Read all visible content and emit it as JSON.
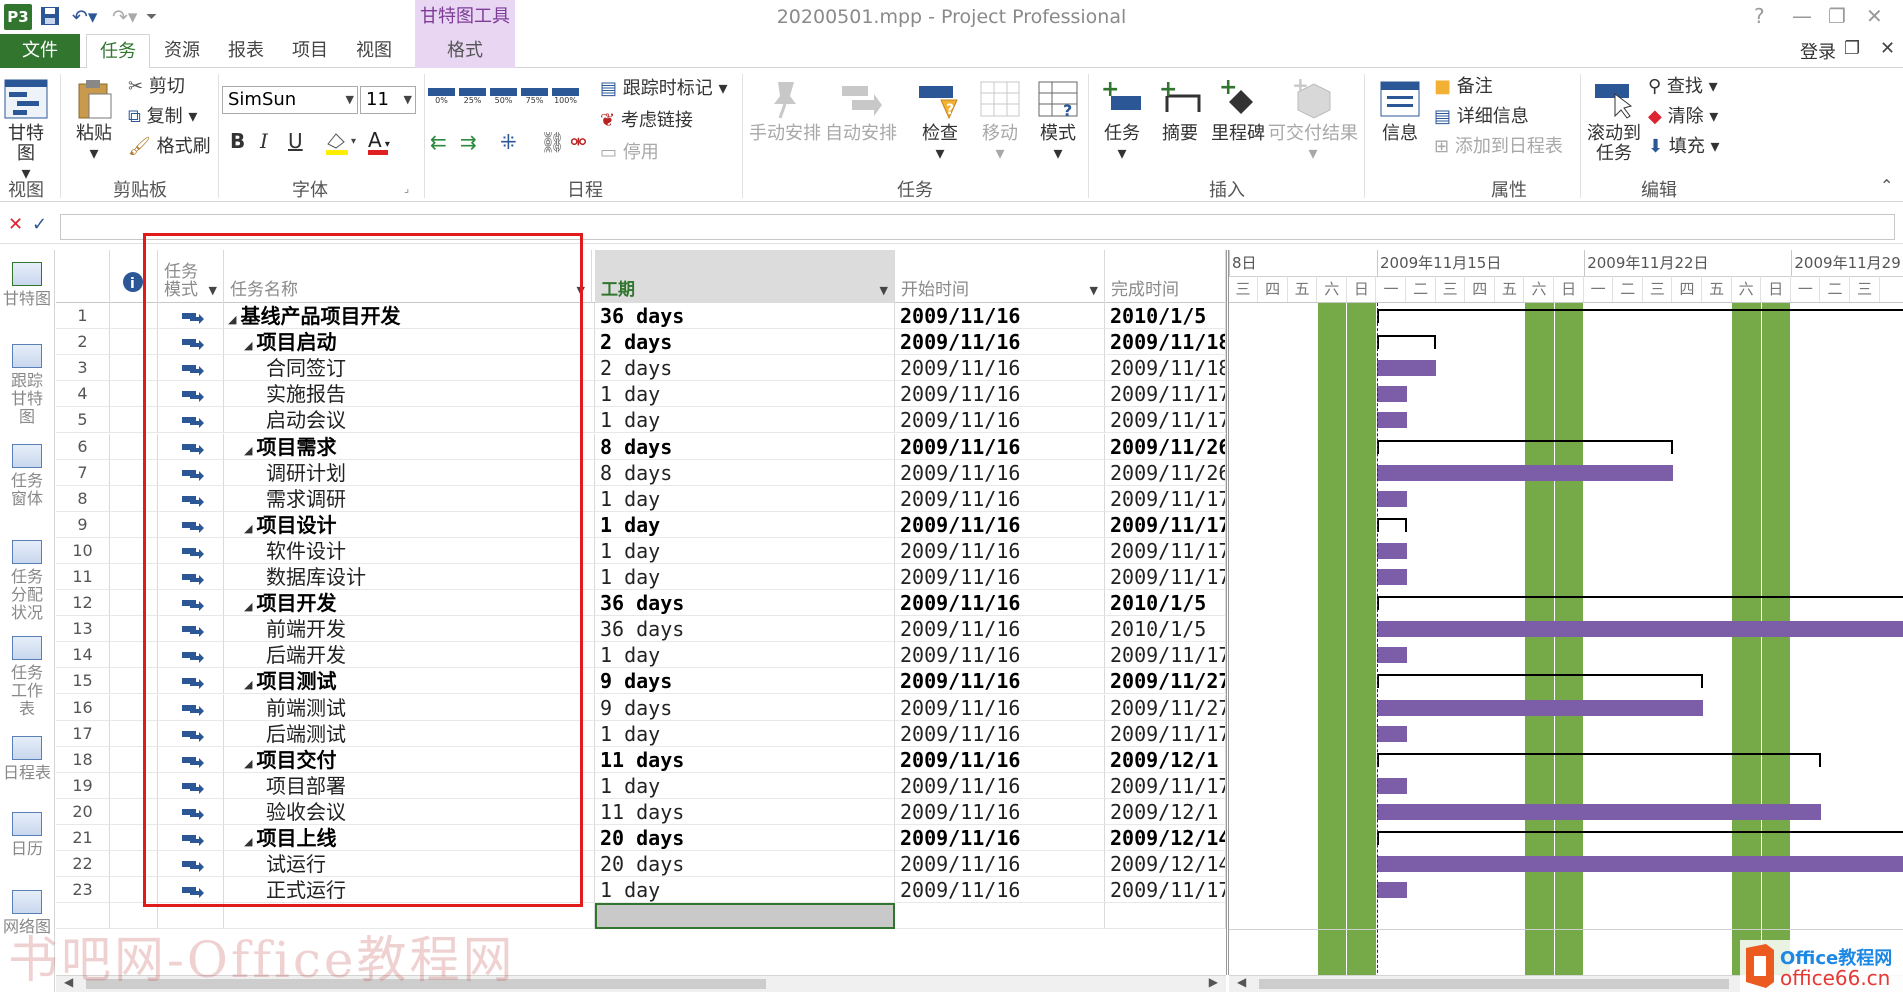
{
  "title_bar": {
    "app_icon": "P3",
    "window_title": "20200501.mpp - Project Professional",
    "context_tab_group": "甘特图工具",
    "help": "?",
    "signin": "登录"
  },
  "tabs": [
    "文件",
    "任务",
    "资源",
    "报表",
    "项目",
    "视图",
    "格式"
  ],
  "ribbon": {
    "view": {
      "gantt_chart": "甘特图",
      "group": "视图"
    },
    "clipboard": {
      "paste": "粘贴",
      "cut": "剪切",
      "copy": "复制",
      "format_painter": "格式刷",
      "group": "剪贴板"
    },
    "font": {
      "name": "SimSun",
      "size": "11",
      "bold": "B",
      "italic": "I",
      "underline": "U",
      "font_color": "A",
      "group": "字体"
    },
    "schedule": {
      "percent_buttons": [
        "0%",
        "25%",
        "50%",
        "75%",
        "100%"
      ],
      "track": "跟踪时标记",
      "respect_links": "考虑链接",
      "inactivate": "停用",
      "group": "日程"
    },
    "tasks": {
      "manual": "手动安排",
      "auto": "自动安排",
      "inspect": "检查",
      "move": "移动",
      "mode": "模式",
      "group": "任务"
    },
    "insert": {
      "task": "任务",
      "summary": "摘要",
      "milestone": "里程碑",
      "deliverable": "可交付结果",
      "group": "插入"
    },
    "properties": {
      "info": "信息",
      "notes": "备注",
      "details": "详细信息",
      "add_timeline": "添加到日程表",
      "group": "属性"
    },
    "editing": {
      "scroll_to_task": "滚动到任务",
      "find": "查找",
      "clear": "清除",
      "fill": "填充",
      "group": "编辑"
    }
  },
  "viewbar": [
    "甘特图",
    "跟踪甘特图",
    "任务窗体",
    "任务分配状况",
    "任务工作表",
    "日程表",
    "日历",
    "网络图"
  ],
  "grid": {
    "columns": {
      "info": "i",
      "mode": "任务模式",
      "name": "任务名称",
      "duration": "工期",
      "start": "开始时间",
      "finish": "完成时间"
    },
    "rows": [
      {
        "id": "1",
        "name": "基线产品项目开发",
        "level": 0,
        "summary": true,
        "duration": "36 days",
        "start": "2009/11/16",
        "finish": "2010/1/5"
      },
      {
        "id": "2",
        "name": "项目启动",
        "level": 1,
        "summary": true,
        "duration": "2 days",
        "start": "2009/11/16",
        "finish": "2009/11/18"
      },
      {
        "id": "3",
        "name": "合同签订",
        "level": 2,
        "summary": false,
        "duration": "2 days",
        "start": "2009/11/16",
        "finish": "2009/11/18"
      },
      {
        "id": "4",
        "name": "实施报告",
        "level": 2,
        "summary": false,
        "duration": "1 day",
        "start": "2009/11/16",
        "finish": "2009/11/17"
      },
      {
        "id": "5",
        "name": "启动会议",
        "level": 2,
        "summary": false,
        "duration": "1 day",
        "start": "2009/11/16",
        "finish": "2009/11/17"
      },
      {
        "id": "6",
        "name": "项目需求",
        "level": 1,
        "summary": true,
        "duration": "8 days",
        "start": "2009/11/16",
        "finish": "2009/11/26"
      },
      {
        "id": "7",
        "name": "调研计划",
        "level": 2,
        "summary": false,
        "duration": "8 days",
        "start": "2009/11/16",
        "finish": "2009/11/26"
      },
      {
        "id": "8",
        "name": "需求调研",
        "level": 2,
        "summary": false,
        "duration": "1 day",
        "start": "2009/11/16",
        "finish": "2009/11/17"
      },
      {
        "id": "9",
        "name": "项目设计",
        "level": 1,
        "summary": true,
        "duration": "1 day",
        "start": "2009/11/16",
        "finish": "2009/11/17"
      },
      {
        "id": "10",
        "name": "软件设计",
        "level": 2,
        "summary": false,
        "duration": "1 day",
        "start": "2009/11/16",
        "finish": "2009/11/17"
      },
      {
        "id": "11",
        "name": "数据库设计",
        "level": 2,
        "summary": false,
        "duration": "1 day",
        "start": "2009/11/16",
        "finish": "2009/11/17"
      },
      {
        "id": "12",
        "name": "项目开发",
        "level": 1,
        "summary": true,
        "duration": "36 days",
        "start": "2009/11/16",
        "finish": "2010/1/5"
      },
      {
        "id": "13",
        "name": "前端开发",
        "level": 2,
        "summary": false,
        "duration": "36 days",
        "start": "2009/11/16",
        "finish": "2010/1/5"
      },
      {
        "id": "14",
        "name": "后端开发",
        "level": 2,
        "summary": false,
        "duration": "1 day",
        "start": "2009/11/16",
        "finish": "2009/11/17"
      },
      {
        "id": "15",
        "name": "项目测试",
        "level": 1,
        "summary": true,
        "duration": "9 days",
        "start": "2009/11/16",
        "finish": "2009/11/27"
      },
      {
        "id": "16",
        "name": "前端测试",
        "level": 2,
        "summary": false,
        "duration": "9 days",
        "start": "2009/11/16",
        "finish": "2009/11/27"
      },
      {
        "id": "17",
        "name": "后端测试",
        "level": 2,
        "summary": false,
        "duration": "1 day",
        "start": "2009/11/16",
        "finish": "2009/11/17"
      },
      {
        "id": "18",
        "name": "项目交付",
        "level": 1,
        "summary": true,
        "duration": "11 days",
        "start": "2009/11/16",
        "finish": "2009/12/1"
      },
      {
        "id": "19",
        "name": "项目部署",
        "level": 2,
        "summary": false,
        "duration": "1 day",
        "start": "2009/11/16",
        "finish": "2009/11/17"
      },
      {
        "id": "20",
        "name": "验收会议",
        "level": 2,
        "summary": false,
        "duration": "11 days",
        "start": "2009/11/16",
        "finish": "2009/12/1"
      },
      {
        "id": "21",
        "name": "项目上线",
        "level": 1,
        "summary": true,
        "duration": "20 days",
        "start": "2009/11/16",
        "finish": "2009/12/14"
      },
      {
        "id": "22",
        "name": "试运行",
        "level": 2,
        "summary": false,
        "duration": "20 days",
        "start": "2009/11/16",
        "finish": "2009/12/14"
      },
      {
        "id": "23",
        "name": "正式运行",
        "level": 2,
        "summary": false,
        "duration": "1 day",
        "start": "2009/11/16",
        "finish": "2009/11/17"
      }
    ]
  },
  "gantt": {
    "week_labels": [
      "8日",
      "2009年11月15日",
      "2009年11月22日",
      "2009年11月29日"
    ],
    "day_letters": [
      "三",
      "四",
      "五",
      "六",
      "日",
      "一",
      "二",
      "三",
      "四",
      "五",
      "六",
      "日",
      "一",
      "二",
      "三",
      "四",
      "五",
      "六",
      "日",
      "一",
      "二",
      "三"
    ],
    "weekend_color": "#76aa48",
    "bar_color": "#7b5ea7"
  },
  "watermark": "书吧网-Office教程网",
  "logo": {
    "line1": "Office教程网",
    "line2": "office66.cn"
  }
}
